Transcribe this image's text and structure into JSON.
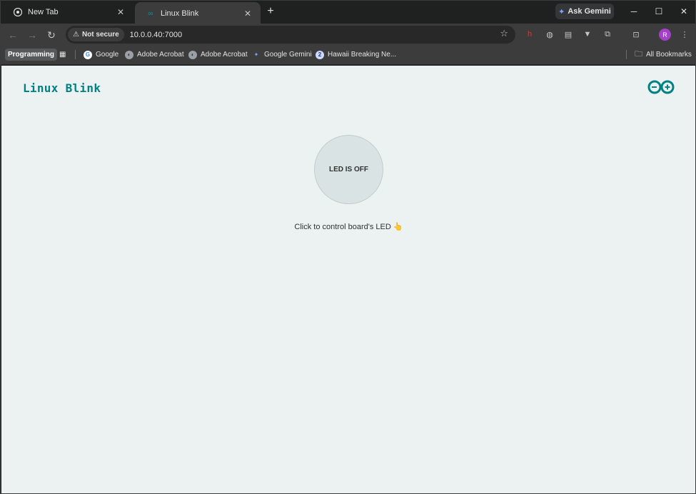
{
  "browser": {
    "tabs": [
      {
        "title": "New Tab",
        "active": false
      },
      {
        "title": "Linux Blink",
        "active": true
      }
    ],
    "gemini_label": "Ask Gemini",
    "security_label": "Not secure",
    "url": "10.0.0.40:7000",
    "avatar_initial": "R",
    "bookmarks": [
      {
        "label": "Programming",
        "kind": "folder-chip"
      },
      {
        "label": "Google",
        "icon": "google-icon"
      },
      {
        "label": "Adobe Acrobat",
        "icon": "globe-icon"
      },
      {
        "label": "Adobe Acrobat",
        "icon": "globe-icon"
      },
      {
        "label": "Google Gemini",
        "icon": "gemini-icon"
      },
      {
        "label": "Hawaii Breaking Ne...",
        "icon": "news-icon"
      }
    ],
    "all_bookmarks_label": "All Bookmarks"
  },
  "page": {
    "title": "Linux Blink",
    "led_status": "LED IS OFF",
    "hint": "Click to control board's LED 👆"
  },
  "colors": {
    "accent": "#008184",
    "page_background": "#ecf1f1",
    "led_off": "#dae3e3"
  }
}
